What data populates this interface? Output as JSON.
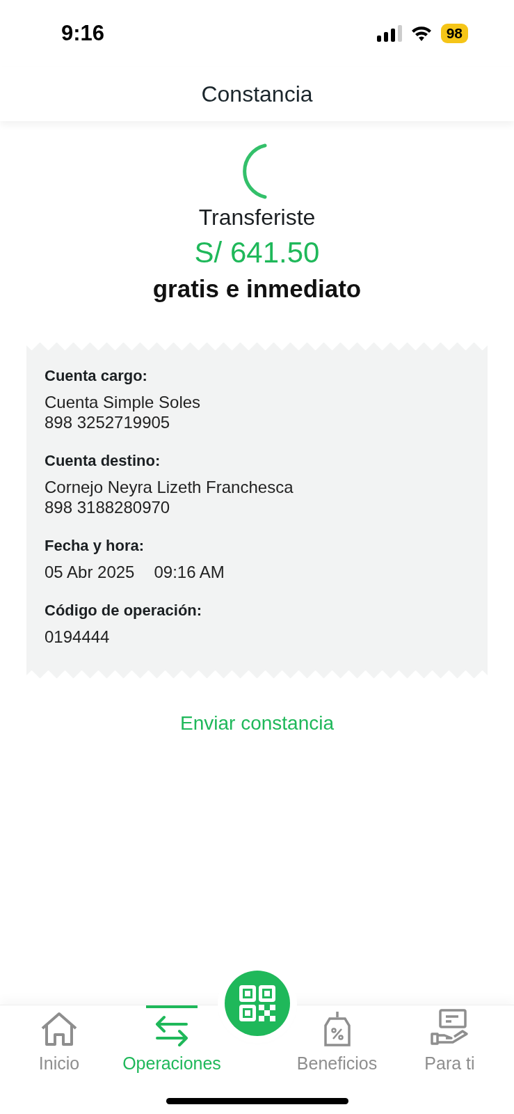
{
  "status_bar": {
    "time": "9:16",
    "battery": "98"
  },
  "header": {
    "title": "Constancia"
  },
  "summary": {
    "caption": "Transferiste",
    "amount": "S/ 641.50",
    "note": "gratis e inmediato"
  },
  "details": [
    {
      "label": "Cuenta cargo:",
      "values": [
        "Cuenta Simple Soles",
        "898 3252719905"
      ],
      "kind": "lines"
    },
    {
      "label": "Cuenta destino:",
      "values": [
        "Cornejo Neyra Lizeth Franchesca",
        "898 3188280970"
      ],
      "kind": "lines"
    },
    {
      "label": "Fecha y hora:",
      "values": [
        "05 Abr 2025",
        "09:16 AM"
      ],
      "kind": "inline"
    },
    {
      "label": "Código de operación:",
      "values": [
        "0194444"
      ],
      "kind": "lines"
    }
  ],
  "send_link": "Enviar constancia",
  "nav": [
    {
      "label": "Inicio",
      "kind": "home",
      "selected": false
    },
    {
      "label": "Operaciones",
      "kind": "transfer",
      "selected": true
    },
    {
      "kind": "qr"
    },
    {
      "label": "Beneficios",
      "kind": "tag",
      "selected": false
    },
    {
      "label": "Para ti",
      "kind": "hand",
      "selected": false
    }
  ]
}
